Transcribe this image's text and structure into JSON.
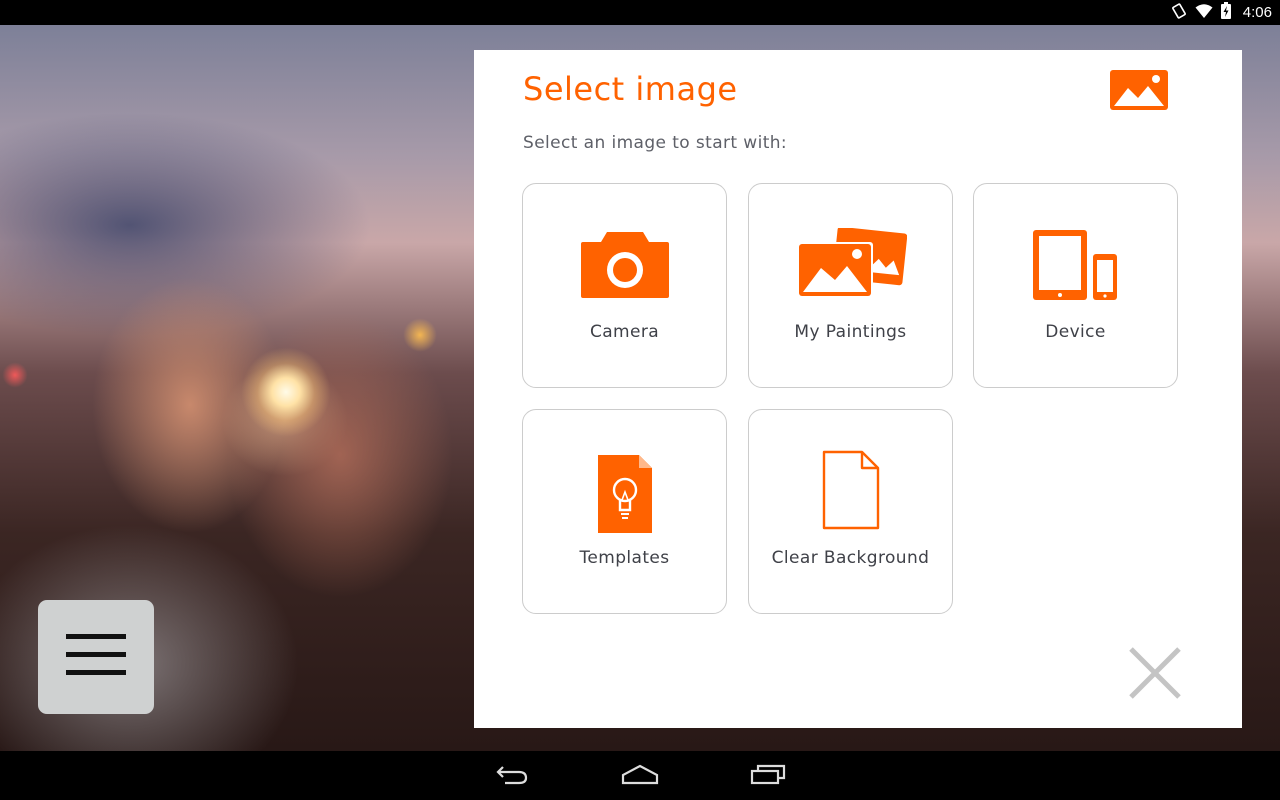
{
  "status_bar": {
    "time": "4:06",
    "icons": [
      "screen-rotation-icon",
      "wifi-icon",
      "battery-charging-icon"
    ]
  },
  "dialog": {
    "title": "Select image",
    "title_icon": "image-icon",
    "subtitle": "Select an image to start with:",
    "options": [
      {
        "label": "Camera",
        "icon": "camera-icon"
      },
      {
        "label": "My Paintings",
        "icon": "paintings-icon"
      },
      {
        "label": "Device",
        "icon": "device-icon"
      },
      {
        "label": "Templates",
        "icon": "template-bulb-icon"
      },
      {
        "label": "Clear Background",
        "icon": "blank-page-icon"
      }
    ],
    "close_icon": "close-icon"
  },
  "menu_button": {
    "icon": "hamburger-menu-icon"
  },
  "nav_bar": {
    "buttons": [
      "back-icon",
      "home-icon",
      "recent-apps-icon"
    ]
  },
  "colors": {
    "accent": "#ff6200",
    "tile_border": "#cccccc",
    "subtitle": "#5e6068",
    "label": "#3f4148"
  }
}
